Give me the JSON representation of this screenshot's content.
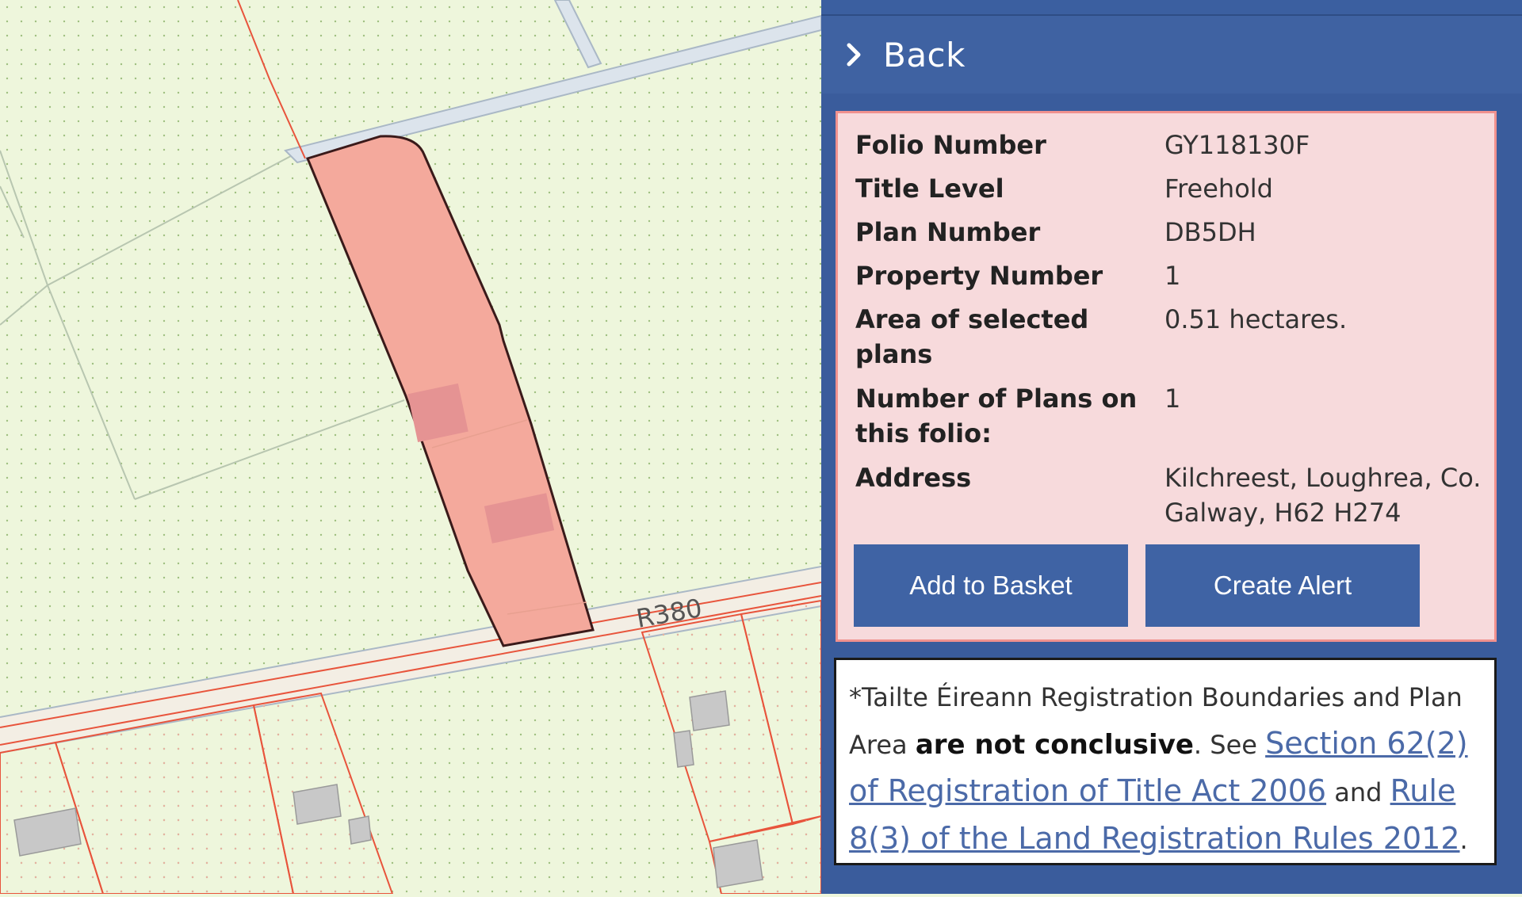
{
  "map": {
    "road_label": "R380",
    "colors": {
      "background": "#eef6dc",
      "selected_parcel": "#f4a99c",
      "boundary": "#e8543c",
      "road": "#dce4ec"
    }
  },
  "panel": {
    "back_label": "Back",
    "fields": [
      {
        "label": "Folio Number",
        "value": "GY118130F"
      },
      {
        "label": "Title Level",
        "value": "Freehold"
      },
      {
        "label": "Plan Number",
        "value": "DB5DH"
      },
      {
        "label": "Property Number",
        "value": "1"
      },
      {
        "label": "Area of selected plans",
        "value": "0.51 hectares."
      },
      {
        "label": "Number of Plans on this folio:",
        "value": "1"
      },
      {
        "label": "Address",
        "value": "Kilchreest, Loughrea, Co. Galway, H62 H274"
      }
    ],
    "buttons": {
      "add_to_basket": "Add to Basket",
      "create_alert": "Create Alert"
    },
    "note": {
      "prefix": "*Tailte Éireann Registration Boundaries and Plan Area ",
      "bold": "are not conclusive",
      "see": ". See ",
      "link1": "Section 62(2) of Registration of Title Act 2006",
      "and": " and ",
      "link2": "Rule 8(3) of the Land Registration Rules 2012",
      "end": "."
    }
  }
}
